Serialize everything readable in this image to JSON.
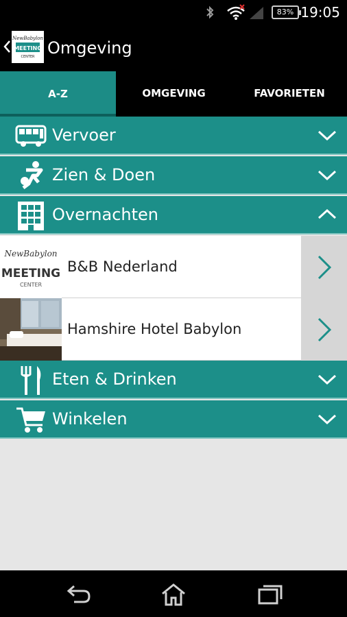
{
  "status": {
    "battery": "83%",
    "time": "19:05"
  },
  "header": {
    "title": "Omgeving"
  },
  "tabs": [
    {
      "label": "A-Z"
    },
    {
      "label": "OMGEVING"
    },
    {
      "label": "FAVORIETEN"
    }
  ],
  "categories": {
    "vervoer": {
      "label": "Vervoer",
      "icon": "bus-icon",
      "expanded": false
    },
    "zien": {
      "label": "Zien & Doen",
      "icon": "soccer-player-icon",
      "expanded": false
    },
    "overnachten": {
      "label": "Overnachten",
      "icon": "building-icon",
      "expanded": true
    },
    "eten": {
      "label": "Eten & Drinken",
      "icon": "fork-knife-icon",
      "expanded": false
    },
    "winkelen": {
      "label": "Winkelen",
      "icon": "shopping-cart-icon",
      "expanded": false
    }
  },
  "overnachten_items": [
    {
      "label": "B&B Nederland"
    },
    {
      "label": "Hamshire Hotel Babylon"
    }
  ],
  "logo": {
    "script": "NewBabylon",
    "main": "MEETING",
    "sub": "CENTER"
  },
  "colors": {
    "accent": "#1c8f89",
    "tab_active": "#1c8c86"
  }
}
